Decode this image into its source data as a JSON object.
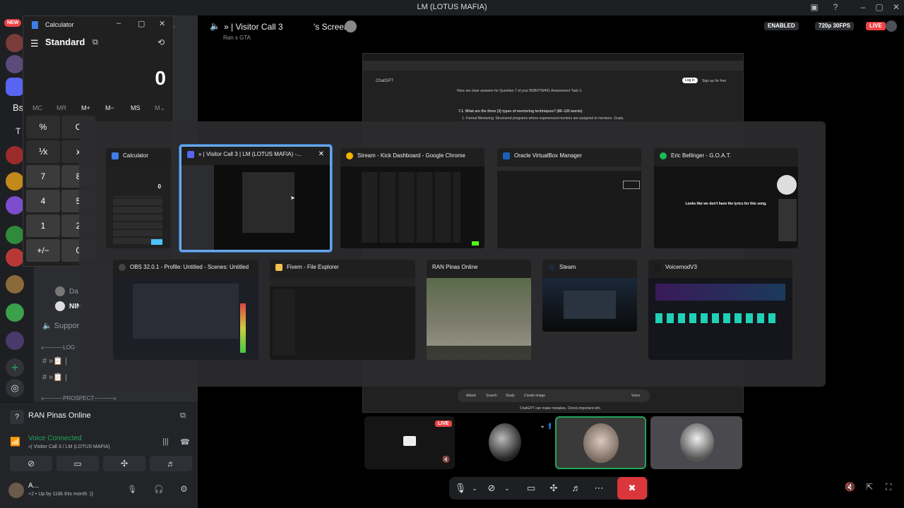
{
  "window": {
    "title": "LM (LOTUS MAFIA)"
  },
  "discord": {
    "new_badge": "NEW",
    "server_letters": [
      "Bs",
      "T"
    ],
    "channels": [
      "Da",
      "NIN",
      "Suppor",
      "»⸺⸺LOG",
      "»⸺⸺PROSPECT⸺⸺«"
    ],
    "voice_panel": {
      "server": "RAN Pinas Online",
      "status": "Voice Connected",
      "channel": "»| Visitor Call 3 / LM (LOTUS MAFIA)",
      "user_name": "A...",
      "user_status": "Up by 118k this month :))"
    }
  },
  "stage": {
    "speaker_name": "» | Visitor Call 3",
    "screen_label": "'s Screen",
    "subtitle": "Ran x GTA",
    "enabled_badge": "ENABLED",
    "quality_badge": "720p 30FPS",
    "live_badge": "LIVE",
    "tile_live_badge": "LIVE"
  },
  "shared_screen": {
    "app_name": "ChatGPT",
    "login": "Log in",
    "signup": "Sign up for free",
    "intro": "Here are clear answers for Question 7 of your BSBXTW401 Assessment Task 1:",
    "question": "7.1. What are the three (3) types of mentoring techniques? (80–120 words)",
    "point": "1. Formal Mentoring: Structured programs where experienced mentors are assigned to mentees. Goals,",
    "footer": "ChatGPT can make mistakes. Check important info.",
    "toolbar": [
      "Attach",
      "Search",
      "Study",
      "Create image",
      "Voice"
    ]
  },
  "calculator": {
    "title": "Calculator",
    "mode": "Standard",
    "display": "0",
    "memory": [
      "MC",
      "MR",
      "M+",
      "M−",
      "MS",
      "M⌄"
    ],
    "keys": [
      "%",
      "C",
      "⅟x",
      "x",
      "7",
      "8",
      "4",
      "5",
      "1",
      "2",
      "+/−",
      "0"
    ]
  },
  "task_switcher": {
    "row1": [
      {
        "title": "Calculator",
        "icon": "#3d7de5"
      },
      {
        "title": "» | Visitor Call 3 | LM (LOTUS MAFIA) -...",
        "icon": "#5865f2"
      },
      {
        "title": "Stream - Kick Dashboard - Google Chrome",
        "icon": "#f2b400"
      },
      {
        "title": "Oracle VirtualBox Manager",
        "icon": "#1b5fb6"
      },
      {
        "title": "Eric Bellinger - G.O.A.T.",
        "icon": "#1db954"
      }
    ],
    "row2": [
      {
        "title": "OBS 32.0.1 - Profile: Untitled - Scenes: Untitled",
        "icon": "#444444"
      },
      {
        "title": "Fivem - File Explorer",
        "icon": "#f2c14e"
      },
      {
        "title": "RAN Pinas Online",
        "icon": "#8b3a2b"
      },
      {
        "title": "Steam",
        "icon": "#1b2838"
      },
      {
        "title": "VoicemodV3",
        "icon": "#1a1a1a"
      }
    ],
    "close_label": "✕",
    "calc_thumb_display": "0",
    "lyrics_message": "Looks like we don't have the lyrics for this song."
  },
  "colors": {
    "accent": "#5865f2",
    "voice_green": "#23a55a",
    "live_red": "#ed4245",
    "selection": "#6aa6e6"
  }
}
